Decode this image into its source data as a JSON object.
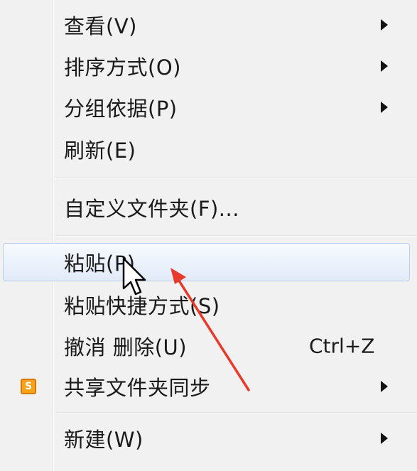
{
  "menu": {
    "items": [
      {
        "label": "查看(V)",
        "submenu": true
      },
      {
        "label": "排序方式(O)",
        "submenu": true
      },
      {
        "label": "分组依据(P)",
        "submenu": true
      },
      {
        "label": "刷新(E)"
      },
      {
        "label": "自定义文件夹(F)..."
      },
      {
        "label": "粘贴(P)",
        "highlighted": true
      },
      {
        "label": "粘贴快捷方式(S)"
      },
      {
        "label": "撤消 删除(U)",
        "shortcut": "Ctrl+Z"
      },
      {
        "label": "共享文件夹同步",
        "submenu": true,
        "icon": "app-icon",
        "icon_text": "S"
      },
      {
        "label": "新建(W)",
        "submenu": true
      }
    ]
  },
  "colors": {
    "menu_background": "#f1f1f1",
    "highlight": "#e1ebf8",
    "annotation_arrow": "#e8392b",
    "app_icon": "#f5a31a"
  },
  "icons": [
    "submenu-arrow-icon",
    "app-icon",
    "mouse-cursor-icon",
    "red-annotation-arrow"
  ]
}
